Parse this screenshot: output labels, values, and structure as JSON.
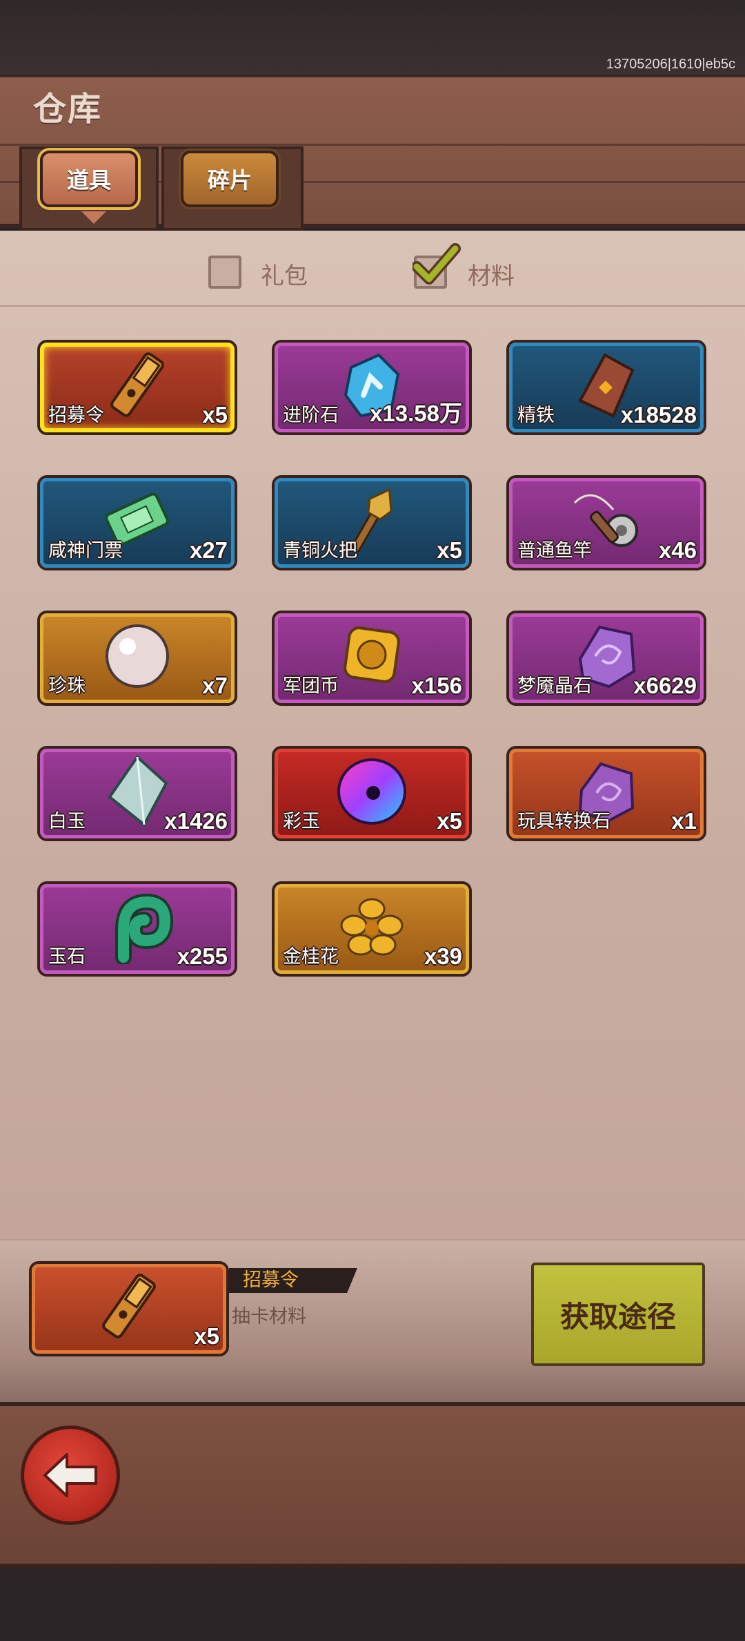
{
  "build_tag": "13705206|1610|eb5c",
  "header": {
    "title": "仓库"
  },
  "tabs": [
    {
      "label": "道具",
      "active": true
    },
    {
      "label": "碎片",
      "active": false
    }
  ],
  "filters": {
    "gift": {
      "label": "礼包",
      "checked": false
    },
    "material": {
      "label": "材料",
      "checked": true
    }
  },
  "items": [
    {
      "name": "招募令",
      "count": "x5",
      "quality": "selected",
      "icon": "recruit-token-icon"
    },
    {
      "name": "进阶石",
      "count": "x13.58万",
      "quality": "purple",
      "icon": "advance-stone-icon"
    },
    {
      "name": "精铁",
      "count": "x18528",
      "quality": "blue",
      "icon": "refined-iron-icon"
    },
    {
      "name": "咸神门票",
      "count": "x27",
      "quality": "blue",
      "icon": "ticket-icon"
    },
    {
      "name": "青铜火把",
      "count": "x5",
      "quality": "blue",
      "icon": "torch-icon"
    },
    {
      "name": "普通鱼竿",
      "count": "x46",
      "quality": "purple",
      "icon": "fishing-rod-icon"
    },
    {
      "name": "珍珠",
      "count": "x7",
      "quality": "gold",
      "icon": "pearl-icon"
    },
    {
      "name": "军团币",
      "count": "x156",
      "quality": "purple",
      "icon": "legion-coin-icon"
    },
    {
      "name": "梦魇晶石",
      "count": "x6629",
      "quality": "purple",
      "icon": "nightmare-crystal-icon"
    },
    {
      "name": "白玉",
      "count": "x1426",
      "quality": "purple",
      "icon": "white-jade-icon"
    },
    {
      "name": "彩玉",
      "count": "x5",
      "quality": "red",
      "icon": "rainbow-jade-icon"
    },
    {
      "name": "玩具转换石",
      "count": "x1",
      "quality": "orange",
      "icon": "toy-stone-icon"
    },
    {
      "name": "玉石",
      "count": "x255",
      "quality": "purple",
      "icon": "jade-stone-icon"
    },
    {
      "name": "金桂花",
      "count": "x39",
      "quality": "gold",
      "icon": "golden-osmanthus-icon"
    }
  ],
  "detail": {
    "name": "招募令",
    "desc": "抽卡材料",
    "count": "x5",
    "button_label": "获取途径"
  }
}
